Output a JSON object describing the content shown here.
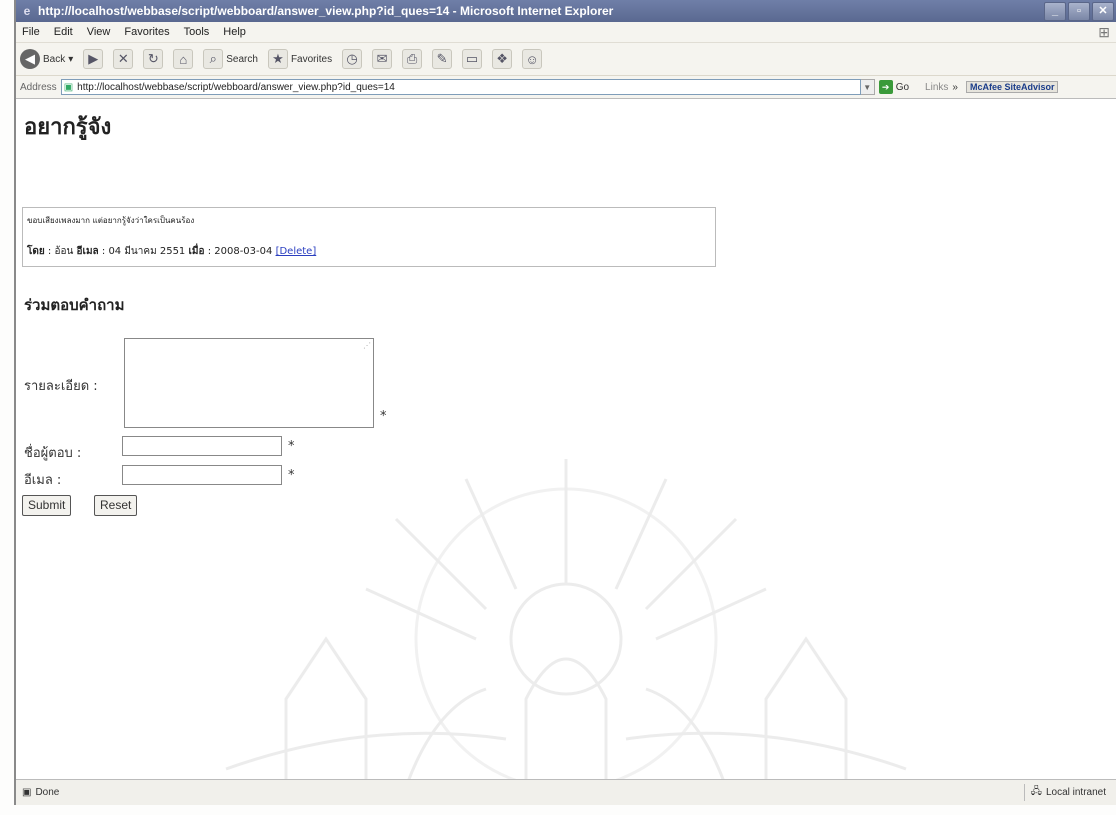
{
  "window": {
    "title": "http://localhost/webbase/script/webboard/answer_view.php?id_ques=14 - Microsoft Internet Explorer"
  },
  "menubar": {
    "items": [
      "File",
      "Edit",
      "View",
      "Favorites",
      "Tools",
      "Help"
    ]
  },
  "toolbar": {
    "back_label": "Back",
    "search_label": "Search",
    "favorites_label": "Favorites"
  },
  "addressbar": {
    "label": "Address",
    "url": "http://localhost/webbase/script/webboard/answer_view.php?id_ques=14",
    "go_label": "Go",
    "links_label": "Links",
    "mcafee_label": "McAfee SiteAdvisor"
  },
  "page": {
    "title": "อยากรู้จัง",
    "question": {
      "text": "ขอบเสียงเพลงมาก แต่อยากรู้จังว่าใครเป็นคนร้อง",
      "by_label": "โดย",
      "author": "อ้อน",
      "email_label": "อีเมล",
      "email": "04 มีนาคม 2551",
      "date_label": "เมื่อ",
      "date": "2008-03-04",
      "delete_label": "[Delete]"
    },
    "answer_form": {
      "section_title": "ร่วมตอบคำถาม",
      "detail_label": "รายละเอียด :",
      "name_label": "ชื่อผู้ตอบ :",
      "email_label": "อีเมล :",
      "required_mark": "*",
      "submit_label": "Submit",
      "reset_label": "Reset"
    }
  },
  "statusbar": {
    "status": "Done",
    "zone": "Local intranet"
  }
}
